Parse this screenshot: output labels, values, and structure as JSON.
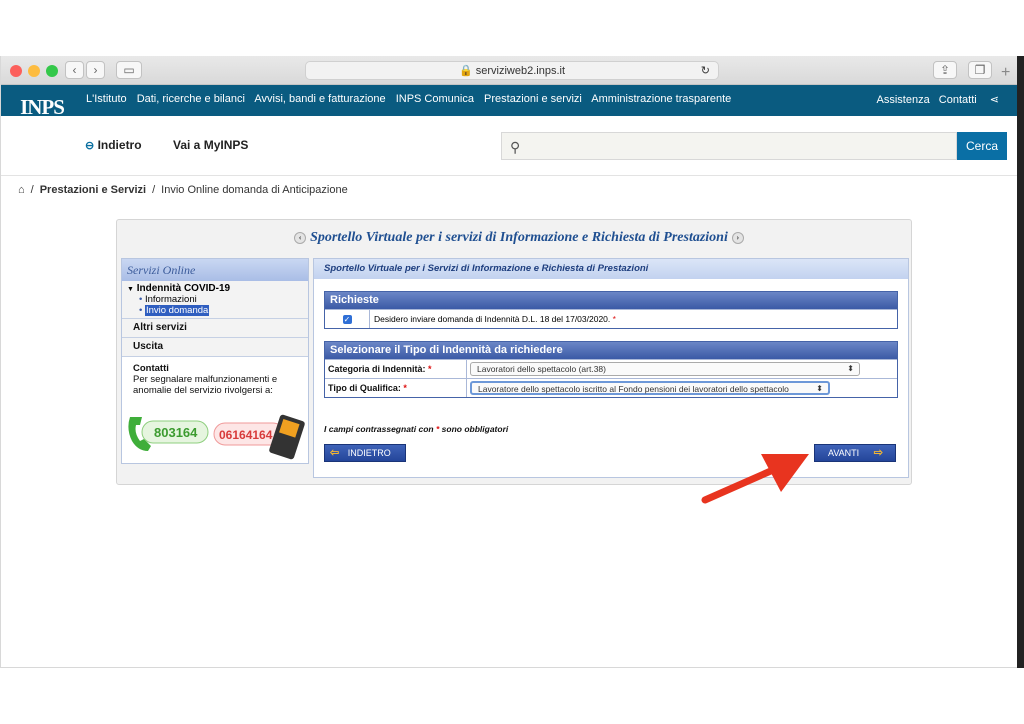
{
  "browser": {
    "url": "serviziweb2.inps.it"
  },
  "header": {
    "logo_text": "INPS",
    "nav_links": [
      "L'Istituto",
      "Dati, ricerche e bilanci",
      "Avvisi, bandi e fatturazione",
      "INPS Comunica",
      "Prestazioni e servizi",
      "Amministrazione trasparente"
    ],
    "assistenza": "Assistenza",
    "contatti": "Contatti",
    "indietro": "Indietro",
    "vai_myinps": "Vai a MyINPS",
    "search_placeholder": "",
    "cerca": "Cerca"
  },
  "breadcrumb": {
    "item1": "Prestazioni e Servizi",
    "item2": "Invio Online domanda di Anticipazione"
  },
  "portal": {
    "title": "Sportello Virtuale per i servizi di Informazione e Richiesta di Prestazioni"
  },
  "sidebar": {
    "title": "Servizi Online",
    "covid_title": "Indennità COVID-19",
    "item_informazioni": "Informazioni",
    "item_invio": "Invio domanda",
    "altri_servizi": "Altri servizi",
    "uscita": "Uscita",
    "contatti_title": "Contatti",
    "contatti_text": "Per segnalare malfunzionamenti e anomalie del servizio rivolgersi a:",
    "phone_green": "803164",
    "phone_red": "06164164"
  },
  "main": {
    "panel_title": "Sportello Virtuale per i Servizi di Informazione e Richiesta di Prestazioni",
    "richieste_title": "Richieste",
    "richieste_checkbox_label": "Desidero inviare domanda di Indennità D.L. 18 del 17/03/2020.",
    "richieste_checked": true,
    "tipo_title": "Selezionare il Tipo di Indennità da richiedere",
    "categoria_label": "Categoria di Indennità:",
    "categoria_value": "Lavoratori dello spettacolo (art.38)",
    "qualifica_label": "Tipo di Qualifica:",
    "qualifica_value": "Lavoratore dello spettacolo iscritto al Fondo pensioni dei lavoratori dello spettacolo",
    "obbligatori_prefix": "I campi contrassegnati con",
    "obbligatori_suffix": "sono obbligatori",
    "required_mark": "*",
    "btn_indietro": "INDIETRO",
    "btn_avanti": "AVANTI"
  },
  "colors": {
    "inps_blue": "#0a5b80",
    "arrow_red": "#e8341f",
    "button_blue": "#2a4da3"
  }
}
